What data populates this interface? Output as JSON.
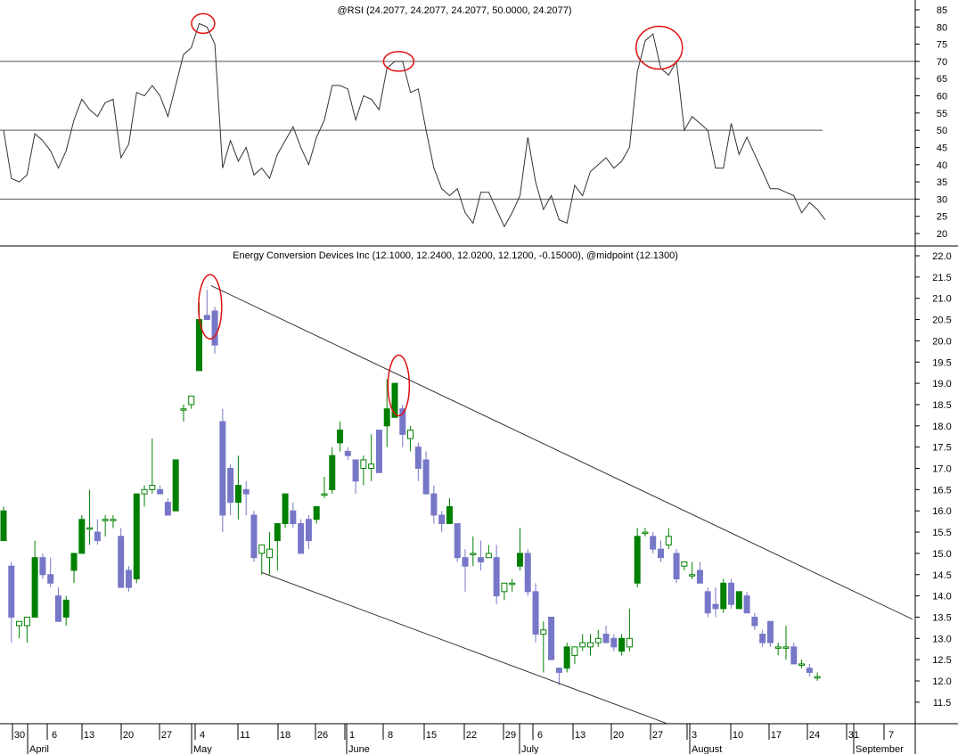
{
  "chart_data": [
    {
      "type": "line",
      "title": "@RSI (24.2077, 24.2077, 24.2077, 50.0000, 24.2077)",
      "ylim": [
        17.5,
        87.5
      ],
      "y_ticks": [
        "20",
        "25",
        "30",
        "35",
        "40",
        "45",
        "50",
        "55",
        "60",
        "65",
        "70",
        "75",
        "80",
        "85"
      ],
      "reference_lines": [
        30,
        50,
        70
      ],
      "series": [
        {
          "values": [
            50,
            36,
            35,
            37,
            49,
            47,
            44,
            39,
            44,
            53,
            59,
            56,
            54,
            58,
            59,
            42,
            46,
            61,
            60,
            63,
            60,
            54,
            63,
            72,
            74,
            81,
            80,
            75,
            39,
            47,
            41,
            45,
            37,
            39,
            36,
            43,
            47,
            51,
            45,
            40,
            48,
            53,
            63,
            63,
            62,
            53,
            60,
            59,
            56,
            68,
            70,
            70,
            61,
            62,
            50,
            39,
            33,
            31,
            33,
            26,
            23,
            32,
            32,
            27,
            22,
            26,
            31,
            48,
            35,
            27,
            31,
            24,
            23,
            34,
            31,
            38,
            40,
            42,
            39,
            41,
            45,
            67,
            76,
            78,
            68,
            66,
            70,
            50,
            54,
            52,
            50,
            39,
            39,
            52,
            43,
            48,
            43,
            38,
            33,
            33,
            32,
            31,
            26,
            29,
            27,
            24
          ]
        }
      ],
      "annotations": [
        "red ellipse at early-May RSI peak",
        "red ellipse at early-June RSI peak",
        "red ellipse at late-July RSI peak"
      ]
    },
    {
      "type": "candlestick",
      "title": "Energy Conversion Devices Inc (12.1000, 12.2400, 12.0200, 12.1200, -0.15000), @midpoint (12.1300)",
      "ylim": [
        11.0,
        22.0
      ],
      "y_ticks": [
        "11.5",
        "12.0",
        "12.5",
        "13.0",
        "13.5",
        "14.0",
        "14.5",
        "15.0",
        "15.5",
        "16.0",
        "16.5",
        "17.0",
        "17.5",
        "18.0",
        "18.5",
        "19.0",
        "19.5",
        "20.0",
        "20.5",
        "21.0",
        "21.5",
        "22.0"
      ],
      "colors": {
        "up": "#008000",
        "down": "#7777c8"
      },
      "x_tick_labels": [
        "30",
        "6",
        "13",
        "20",
        "27",
        "4",
        "11",
        "18",
        "26",
        "1",
        "8",
        "15",
        "22",
        "29",
        "6",
        "13",
        "20",
        "27",
        "3",
        "10",
        "17",
        "24",
        "31",
        "7"
      ],
      "month_labels": [
        "April",
        "May",
        "June",
        "July",
        "August",
        "September"
      ],
      "candles": [
        [
          15.3,
          16.1,
          15.3,
          16.0
        ],
        [
          14.7,
          14.8,
          12.9,
          13.5
        ],
        [
          13.3,
          13.4,
          13.0,
          13.4
        ],
        [
          13.3,
          13.5,
          12.9,
          13.5
        ],
        [
          13.5,
          15.3,
          13.5,
          14.9
        ],
        [
          14.9,
          15.0,
          14.4,
          14.5
        ],
        [
          14.5,
          14.9,
          14.2,
          14.3
        ],
        [
          14.0,
          14.2,
          13.4,
          13.4
        ],
        [
          13.5,
          14.0,
          13.3,
          13.9
        ],
        [
          14.6,
          15.0,
          14.3,
          15.0
        ],
        [
          15.0,
          15.9,
          15.0,
          15.8
        ],
        [
          15.6,
          16.5,
          15.2,
          15.6
        ],
        [
          15.5,
          15.8,
          15.2,
          15.3
        ],
        [
          15.8,
          15.9,
          15.4,
          15.8
        ],
        [
          15.8,
          15.9,
          15.6,
          15.8
        ],
        [
          15.4,
          15.6,
          14.2,
          14.2
        ],
        [
          14.6,
          14.7,
          14.1,
          14.2
        ],
        [
          14.4,
          16.3,
          14.3,
          16.4
        ],
        [
          16.4,
          16.6,
          16.1,
          16.5
        ],
        [
          16.5,
          17.7,
          16.4,
          16.6
        ],
        [
          16.5,
          16.6,
          16.4,
          16.4
        ],
        [
          16.2,
          16.3,
          15.9,
          15.9
        ],
        [
          16.0,
          17.2,
          16.0,
          17.2
        ],
        [
          18.4,
          18.5,
          18.1,
          18.4
        ],
        [
          18.5,
          18.7,
          18.4,
          18.7
        ],
        [
          19.3,
          20.9,
          19.3,
          20.5
        ],
        [
          20.6,
          21.2,
          20.5,
          20.5
        ],
        [
          20.7,
          20.8,
          19.7,
          19.9
        ],
        [
          18.1,
          18.4,
          15.5,
          15.9
        ],
        [
          17.0,
          17.1,
          15.9,
          16.2
        ],
        [
          16.2,
          17.3,
          15.8,
          16.6
        ],
        [
          16.5,
          16.7,
          15.9,
          16.4
        ],
        [
          15.9,
          16.0,
          14.8,
          14.9
        ],
        [
          15.0,
          15.2,
          14.5,
          15.2
        ],
        [
          14.9,
          15.5,
          14.5,
          15.1
        ],
        [
          15.3,
          15.7,
          14.6,
          15.7
        ],
        [
          15.7,
          16.4,
          15.6,
          16.4
        ],
        [
          16.0,
          16.2,
          15.6,
          15.7
        ],
        [
          15.7,
          15.8,
          15.0,
          15.0
        ],
        [
          15.8,
          15.9,
          15.1,
          15.3
        ],
        [
          15.8,
          16.1,
          15.7,
          16.1
        ],
        [
          16.4,
          16.8,
          16.3,
          16.4
        ],
        [
          16.5,
          17.5,
          16.4,
          17.3
        ],
        [
          17.6,
          18.1,
          17.4,
          17.9
        ],
        [
          17.4,
          17.5,
          17.2,
          17.3
        ],
        [
          17.2,
          17.2,
          16.4,
          16.7
        ],
        [
          17.0,
          17.3,
          16.6,
          17.2
        ],
        [
          17.0,
          17.8,
          16.7,
          17.1
        ],
        [
          17.9,
          17.9,
          16.9,
          16.9
        ],
        [
          18.0,
          19.1,
          17.5,
          18.4
        ],
        [
          18.2,
          19.0,
          18.2,
          19.0
        ],
        [
          18.4,
          18.5,
          17.5,
          17.8
        ],
        [
          17.7,
          18.0,
          17.4,
          17.9
        ],
        [
          17.5,
          17.6,
          16.7,
          17.0
        ],
        [
          17.2,
          17.4,
          16.4,
          16.4
        ],
        [
          16.4,
          16.6,
          15.7,
          15.9
        ],
        [
          15.9,
          16.0,
          15.5,
          15.7
        ],
        [
          15.7,
          16.3,
          15.7,
          16.1
        ],
        [
          15.7,
          15.7,
          14.8,
          14.9
        ],
        [
          14.9,
          15.1,
          14.1,
          14.7
        ],
        [
          15.0,
          15.4,
          14.7,
          15.0
        ],
        [
          14.9,
          15.3,
          14.6,
          14.8
        ],
        [
          14.9,
          15.2,
          14.9,
          15.0
        ],
        [
          14.9,
          15.2,
          13.8,
          14.0
        ],
        [
          14.1,
          14.3,
          13.9,
          14.3
        ],
        [
          14.3,
          14.4,
          14.1,
          14.3
        ],
        [
          14.7,
          15.6,
          14.6,
          15.0
        ],
        [
          15.0,
          15.1,
          14.0,
          14.1
        ],
        [
          14.1,
          14.3,
          12.9,
          13.1
        ],
        [
          13.1,
          13.4,
          12.2,
          13.2
        ],
        [
          13.5,
          13.5,
          12.5,
          12.5
        ],
        [
          12.3,
          12.3,
          11.9,
          12.2
        ],
        [
          12.3,
          12.9,
          12.2,
          12.8
        ],
        [
          12.6,
          12.8,
          12.4,
          12.8
        ],
        [
          12.8,
          13.1,
          12.7,
          12.9
        ],
        [
          12.8,
          13.1,
          12.6,
          12.9
        ],
        [
          12.9,
          13.2,
          12.8,
          13.0
        ],
        [
          13.1,
          13.3,
          13.0,
          12.9
        ],
        [
          13.0,
          13.1,
          12.7,
          12.8
        ],
        [
          12.7,
          13.1,
          12.6,
          13.0
        ],
        [
          12.8,
          13.7,
          12.7,
          13.0
        ],
        [
          14.3,
          15.6,
          14.2,
          15.4
        ],
        [
          15.5,
          15.6,
          15.4,
          15.5
        ],
        [
          15.4,
          15.5,
          15.0,
          15.1
        ],
        [
          15.1,
          15.3,
          14.8,
          14.9
        ],
        [
          15.2,
          15.6,
          15.1,
          15.4
        ],
        [
          15.0,
          15.1,
          14.3,
          14.4
        ],
        [
          14.7,
          14.8,
          14.6,
          14.8
        ],
        [
          14.5,
          14.8,
          14.4,
          14.5
        ],
        [
          14.6,
          14.8,
          14.3,
          14.3
        ],
        [
          14.1,
          14.2,
          13.5,
          13.6
        ],
        [
          13.8,
          14.2,
          13.5,
          13.7
        ],
        [
          13.7,
          14.4,
          13.6,
          14.3
        ],
        [
          14.3,
          14.4,
          13.7,
          13.8
        ],
        [
          13.7,
          14.1,
          13.7,
          14.1
        ],
        [
          14.0,
          14.1,
          13.6,
          13.6
        ],
        [
          13.5,
          13.6,
          13.2,
          13.3
        ],
        [
          13.1,
          13.2,
          12.8,
          12.9
        ],
        [
          13.4,
          13.4,
          12.8,
          12.9
        ],
        [
          12.8,
          12.9,
          12.6,
          12.8
        ],
        [
          12.8,
          13.3,
          12.5,
          12.8
        ],
        [
          12.8,
          12.9,
          12.4,
          12.4
        ],
        [
          12.4,
          12.5,
          12.3,
          12.4
        ],
        [
          12.3,
          12.4,
          12.1,
          12.2
        ],
        [
          12.1,
          12.2,
          12.0,
          12.1
        ]
      ],
      "annotations": [
        "red ellipse at early-May price high",
        "red ellipse at early-June price high",
        "descending trend channel lines"
      ]
    }
  ]
}
